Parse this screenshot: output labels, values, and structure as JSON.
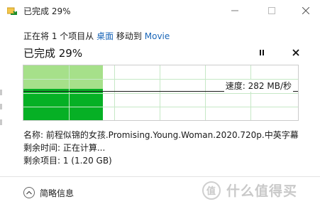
{
  "window": {
    "title": "已完成 29%",
    "minimize_icon": "minimize-icon",
    "maximize_icon": "maximize-icon",
    "close_icon": "close-icon"
  },
  "status": {
    "prefix": "正在将 1 个项目从 ",
    "source": "桌面",
    "middle": " 移动到 ",
    "destination": "Movie"
  },
  "progress": {
    "heading": "已完成 29%",
    "percent": 29,
    "pause_icon": "pause-icon",
    "cancel_icon": "close-icon"
  },
  "graph": {
    "speed_label": "速度: 282 MB/秒",
    "fill_color": "#a6e08a",
    "speed_color": "#06b025"
  },
  "details": {
    "name": "名称: 前程似锦的女孩.Promising.Young.Woman.2020.720p.中英字幕",
    "time_remaining": "剩余时间: 正在计算...",
    "items_remaining": "剩余项目: 1 (1.20 GB)"
  },
  "footer": {
    "collapse_label": "简略信息",
    "collapse_icon": "chevron-up-icon"
  },
  "watermark": {
    "badge": "值",
    "text": "什么值得买"
  },
  "colors": {
    "link": "#1a66b8",
    "accent_green": "#06b025"
  }
}
